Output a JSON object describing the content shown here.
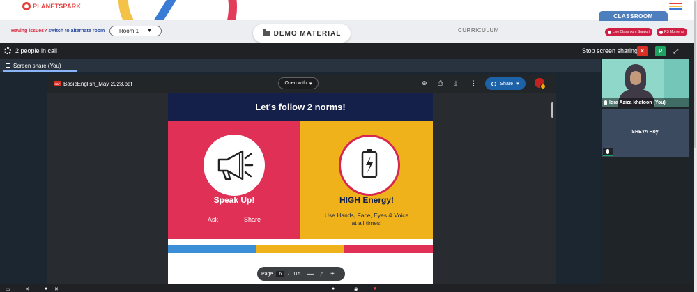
{
  "site": {
    "logo_text": "PLANETSPARK",
    "issues_text": "Having issues?",
    "switch_text": "switch to alternate room",
    "room_value": "Room 1",
    "demo_material_label": "DEMO MATERIAL",
    "curriculum_label": "CURRICULUM",
    "classroom_label": "CLASSROOM",
    "live_support_label": "Live Classroom Support",
    "ps_moments_label": "PS Moments",
    "hamburger_colors": [
      "#e2403f",
      "#f3c247",
      "#3a7bd5"
    ]
  },
  "meet": {
    "people_count_text": "2 people in call",
    "stop_sharing_label": "Stop screen sharing",
    "close_glyph": "✕",
    "participant_initial": "P",
    "expand_glyph": "⤢",
    "tab_label": "Screen share (You)",
    "tab_more": "···"
  },
  "viewer": {
    "file_badge": "PDF",
    "file_name": "BasicEnglish_May 2023.pdf",
    "open_with_label": "Open with",
    "share_label": "Share",
    "page_label": "Page",
    "page_current": "6",
    "page_separator": "/",
    "page_total": "115",
    "zoom_out": "—",
    "zoom_in": "+"
  },
  "slide": {
    "title": "Let's follow 2 norms!",
    "left_heading": "Speak Up!",
    "ask_label": "Ask",
    "share_label": "Share",
    "right_heading": "HIGH Energy!",
    "right_line1": "Use Hands, Face, Eyes & Voice",
    "right_line2": "at all times!",
    "stripe_colors": [
      "#3b8fd6",
      "#efb21b",
      "#e03056"
    ]
  },
  "participants": [
    {
      "name": "Iqra Aziza khatoon (You)"
    },
    {
      "name": "SREYA Roy"
    }
  ]
}
